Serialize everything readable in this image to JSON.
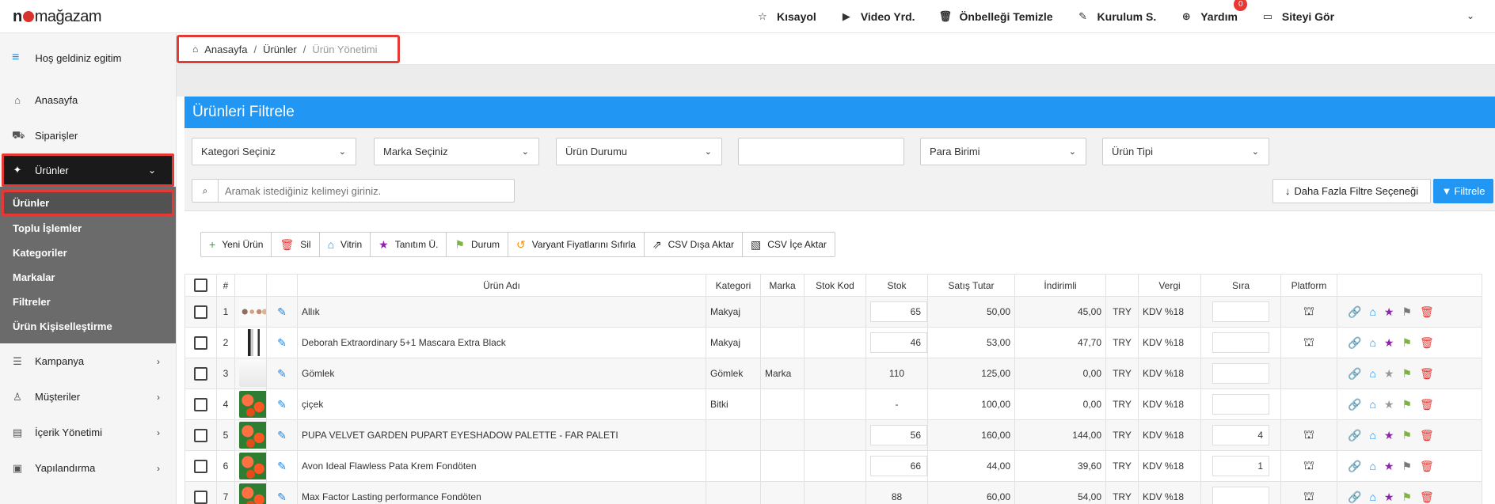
{
  "topbar": {
    "logo_prefix": "n",
    "logo_suffix": "mağazam",
    "nav": [
      {
        "label": "Kısayol",
        "icon": "star-icon",
        "glyph": "☆"
      },
      {
        "label": "Video Yrd.",
        "icon": "youtube-icon",
        "glyph": "▶"
      },
      {
        "label": "Önbelleği Temizle",
        "icon": "trash-icon",
        "glyph": "🗑"
      },
      {
        "label": "Kurulum S.",
        "icon": "magic-wand-icon",
        "glyph": "✎"
      },
      {
        "label": "Yardım",
        "icon": "lifebuoy-icon",
        "glyph": "⊕",
        "badge": "0"
      },
      {
        "label": "Siteyi Gör",
        "icon": "monitor-icon",
        "glyph": "▭"
      }
    ]
  },
  "sidebar": {
    "welcome": "Hoş geldiniz egitim",
    "items_top": [
      {
        "label": "Anasayfa",
        "icon": "home-icon",
        "glyph": "⌂"
      },
      {
        "label": "Siparişler",
        "icon": "cart-icon",
        "glyph": "⛟"
      }
    ],
    "active_item": {
      "label": "Ürünler",
      "icon": "tag-icon",
      "glyph": "✦"
    },
    "submenu": [
      "Ürünler",
      "Toplu İşlemler",
      "Kategoriler",
      "Markalar",
      "Filtreler",
      "Ürün Kişiselleştirme"
    ],
    "items_bottom": [
      {
        "label": "Kampanya",
        "icon": "list-icon",
        "glyph": "☰"
      },
      {
        "label": "Müşteriler",
        "icon": "user-icon",
        "glyph": "♙"
      },
      {
        "label": "İçerik Yönetimi",
        "icon": "content-icon",
        "glyph": "▤"
      },
      {
        "label": "Yapılandırma",
        "icon": "config-icon",
        "glyph": "▣"
      }
    ]
  },
  "breadcrumb": {
    "home": "Anasayfa",
    "section": "Ürünler",
    "current": "Ürün Yönetimi"
  },
  "panel": {
    "title": "Ürünleri Filtrele"
  },
  "filters": {
    "category": "Kategori Seçiniz",
    "brand": "Marka Seçiniz",
    "status": "Ürün Durumu",
    "free_value": "",
    "currency": "Para Birimi",
    "type": "Ürün Tipi",
    "search_placeholder": "Aramak istediğiniz kelimeyi giriniz.",
    "more_label": "Daha Fazla Filtre Seçeneği",
    "filter_label": "Filtrele"
  },
  "toolbar": [
    {
      "label": "Yeni Ürün",
      "icon": "plus-icon",
      "glyph": "+",
      "color": "#43a047"
    },
    {
      "label": "Sil",
      "icon": "trash-icon",
      "glyph": "🗑",
      "color": "#e53935"
    },
    {
      "label": "Vitrin",
      "icon": "house-icon",
      "glyph": "⌂",
      "color": "#1e88e5"
    },
    {
      "label": "Tanıtım Ü.",
      "icon": "star-icon",
      "glyph": "★",
      "color": "#8e24aa"
    },
    {
      "label": "Durum",
      "icon": "flag-icon",
      "glyph": "⚑",
      "color": "#7cb342"
    },
    {
      "label": "Varyant Fiyatlarını Sıfırla",
      "icon": "reset-price-icon",
      "glyph": "↺",
      "color": "#fb8c00"
    },
    {
      "label": "CSV Dışa Aktar",
      "icon": "export-icon",
      "glyph": "⇗",
      "color": "#333333"
    },
    {
      "label": "CSV İçe Aktar",
      "icon": "csv-file-icon",
      "glyph": "▧",
      "color": "#333333"
    }
  ],
  "table": {
    "headers": [
      "#",
      "Ürün Adı",
      "Kategori",
      "Marka",
      "Stok Kod",
      "Stok",
      "Satış Tutar",
      "İndirimli",
      "Vergi",
      "Sıra",
      "Platform"
    ],
    "rows": [
      {
        "no": "1",
        "name": "Allık",
        "category": "Makyaj",
        "brand": "",
        "sku": "",
        "stock": "65",
        "stock_input": true,
        "price": "50,00",
        "discount": "45,00",
        "currency": "TRY",
        "tax": "KDV %18",
        "order": "",
        "platform": true,
        "star": "#8e24aa",
        "flag": "#777777",
        "thumb": "palette"
      },
      {
        "no": "2",
        "name": "Deborah Extraordinary 5+1 Mascara Extra Black",
        "category": "Makyaj",
        "brand": "",
        "sku": "",
        "stock": "46",
        "stock_input": true,
        "price": "53,00",
        "discount": "47,70",
        "currency": "TRY",
        "tax": "KDV %18",
        "order": "",
        "platform": true,
        "star": "#8e24aa",
        "flag": "#7cb342",
        "thumb": "mascara"
      },
      {
        "no": "3",
        "name": "Gömlek",
        "category": "Gömlek",
        "brand": "Marka",
        "sku": "",
        "stock": "110",
        "stock_input": false,
        "price": "125,00",
        "discount": "0,00",
        "currency": "TRY",
        "tax": "KDV %18",
        "order": "",
        "platform": false,
        "star": "#999999",
        "flag": "#7cb342",
        "thumb": "shirt"
      },
      {
        "no": "4",
        "name": "çiçek",
        "category": "Bitki",
        "brand": "",
        "sku": "",
        "stock": "-",
        "stock_input": false,
        "price": "100,00",
        "discount": "0,00",
        "currency": "TRY",
        "tax": "KDV %18",
        "order": "",
        "platform": false,
        "star": "#999999",
        "flag": "#7cb342",
        "thumb": "flower"
      },
      {
        "no": "5",
        "name": "PUPA VELVET GARDEN PUPART EYESHADOW PALETTE - FAR PALETI",
        "category": "",
        "brand": "",
        "sku": "",
        "stock": "56",
        "stock_input": true,
        "price": "160,00",
        "discount": "144,00",
        "currency": "TRY",
        "tax": "KDV %18",
        "order": "4",
        "platform": true,
        "star": "#8e24aa",
        "flag": "#7cb342",
        "thumb": "flower"
      },
      {
        "no": "6",
        "name": "Avon Ideal Flawless Pata Krem Fondöten",
        "category": "",
        "brand": "",
        "sku": "",
        "stock": "66",
        "stock_input": true,
        "price": "44,00",
        "discount": "39,60",
        "currency": "TRY",
        "tax": "KDV %18",
        "order": "1",
        "platform": true,
        "star": "#8e24aa",
        "flag": "#777777",
        "thumb": "flower"
      },
      {
        "no": "7",
        "name": "Max Factor Lasting performance Fondöten",
        "category": "",
        "brand": "",
        "sku": "",
        "stock": "88",
        "stock_input": false,
        "price": "60,00",
        "discount": "54,00",
        "currency": "TRY",
        "tax": "KDV %18",
        "order": "",
        "platform": true,
        "star": "#8e24aa",
        "flag": "#7cb342",
        "thumb": "flower"
      }
    ]
  }
}
